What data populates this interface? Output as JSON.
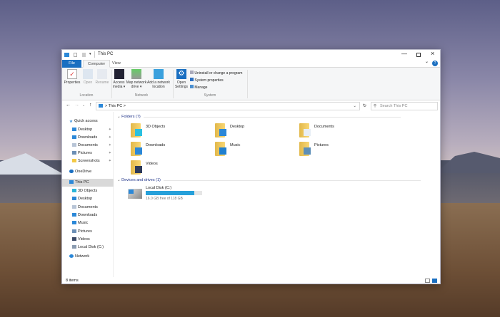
{
  "window": {
    "title": "This PC",
    "controls": [
      "minimize",
      "maximize",
      "close"
    ]
  },
  "tabs": [
    {
      "label": "File"
    },
    {
      "label": "Computer"
    },
    {
      "label": "View"
    }
  ],
  "ribbon": {
    "location": {
      "label": "Location",
      "buttons": [
        {
          "label": "Properties",
          "enabled": true
        },
        {
          "label": "Open",
          "enabled": false
        },
        {
          "label": "Rename",
          "enabled": false
        }
      ]
    },
    "network": {
      "label": "Network",
      "buttons": [
        {
          "label": "Access media ▾"
        },
        {
          "label": "Map network drive ▾"
        },
        {
          "label": "Add a network location"
        }
      ]
    },
    "system": {
      "label": "System",
      "open_settings": "Open Settings",
      "items": [
        "Uninstall or change a program",
        "System properties",
        "Manage"
      ]
    }
  },
  "address": {
    "path": "This PC",
    "separator": ">",
    "search_placeholder": "Search This PC"
  },
  "nav": {
    "quick_access": "Quick access",
    "quick_items": [
      {
        "label": "Desktop",
        "icon": "desktop-icon",
        "color": "#2b88d8"
      },
      {
        "label": "Downloads",
        "icon": "download-icon",
        "color": "#2b88d8"
      },
      {
        "label": "Documents",
        "icon": "document-icon",
        "color": "#b7c4d6"
      },
      {
        "label": "Pictures",
        "icon": "picture-icon",
        "color": "#6c8fb5"
      },
      {
        "label": "Screenshots",
        "icon": "folder-icon",
        "color": "#f3c945"
      }
    ],
    "onedrive": "OneDrive",
    "this_pc": "This PC",
    "pc_items": [
      {
        "label": "3D Objects",
        "color": "#2bb5d8"
      },
      {
        "label": "Desktop",
        "color": "#2b88d8"
      },
      {
        "label": "Documents",
        "color": "#b7c4d6"
      },
      {
        "label": "Downloads",
        "color": "#2b88d8"
      },
      {
        "label": "Music",
        "color": "#2b88d8"
      },
      {
        "label": "Pictures",
        "color": "#6c8fb5"
      },
      {
        "label": "Videos",
        "color": "#3c4a66"
      },
      {
        "label": "Local Disk (C:)",
        "color": "#8a9bb0"
      }
    ],
    "network": "Network"
  },
  "main": {
    "folders_header": "Folders (7)",
    "folders": [
      {
        "label": "3D Objects",
        "overlay": "#2bc0e0"
      },
      {
        "label": "Desktop",
        "overlay": "#2b88d8"
      },
      {
        "label": "Documents",
        "overlay": "#e8eef5"
      },
      {
        "label": "Downloads",
        "overlay": "#2b88d8"
      },
      {
        "label": "Music",
        "overlay": "#1f7fd0"
      },
      {
        "label": "Pictures",
        "overlay": "#5d8fb8"
      },
      {
        "label": "Videos",
        "overlay": "#2d3a5a"
      }
    ],
    "drives_header": "Devices and drives (1)",
    "drive": {
      "label": "Local Disk (C:)",
      "free_text": "16.0 GB free of 118 GB",
      "used_percent": 86
    }
  },
  "status": {
    "items": "8 items"
  },
  "accent": "#1a6fc1"
}
